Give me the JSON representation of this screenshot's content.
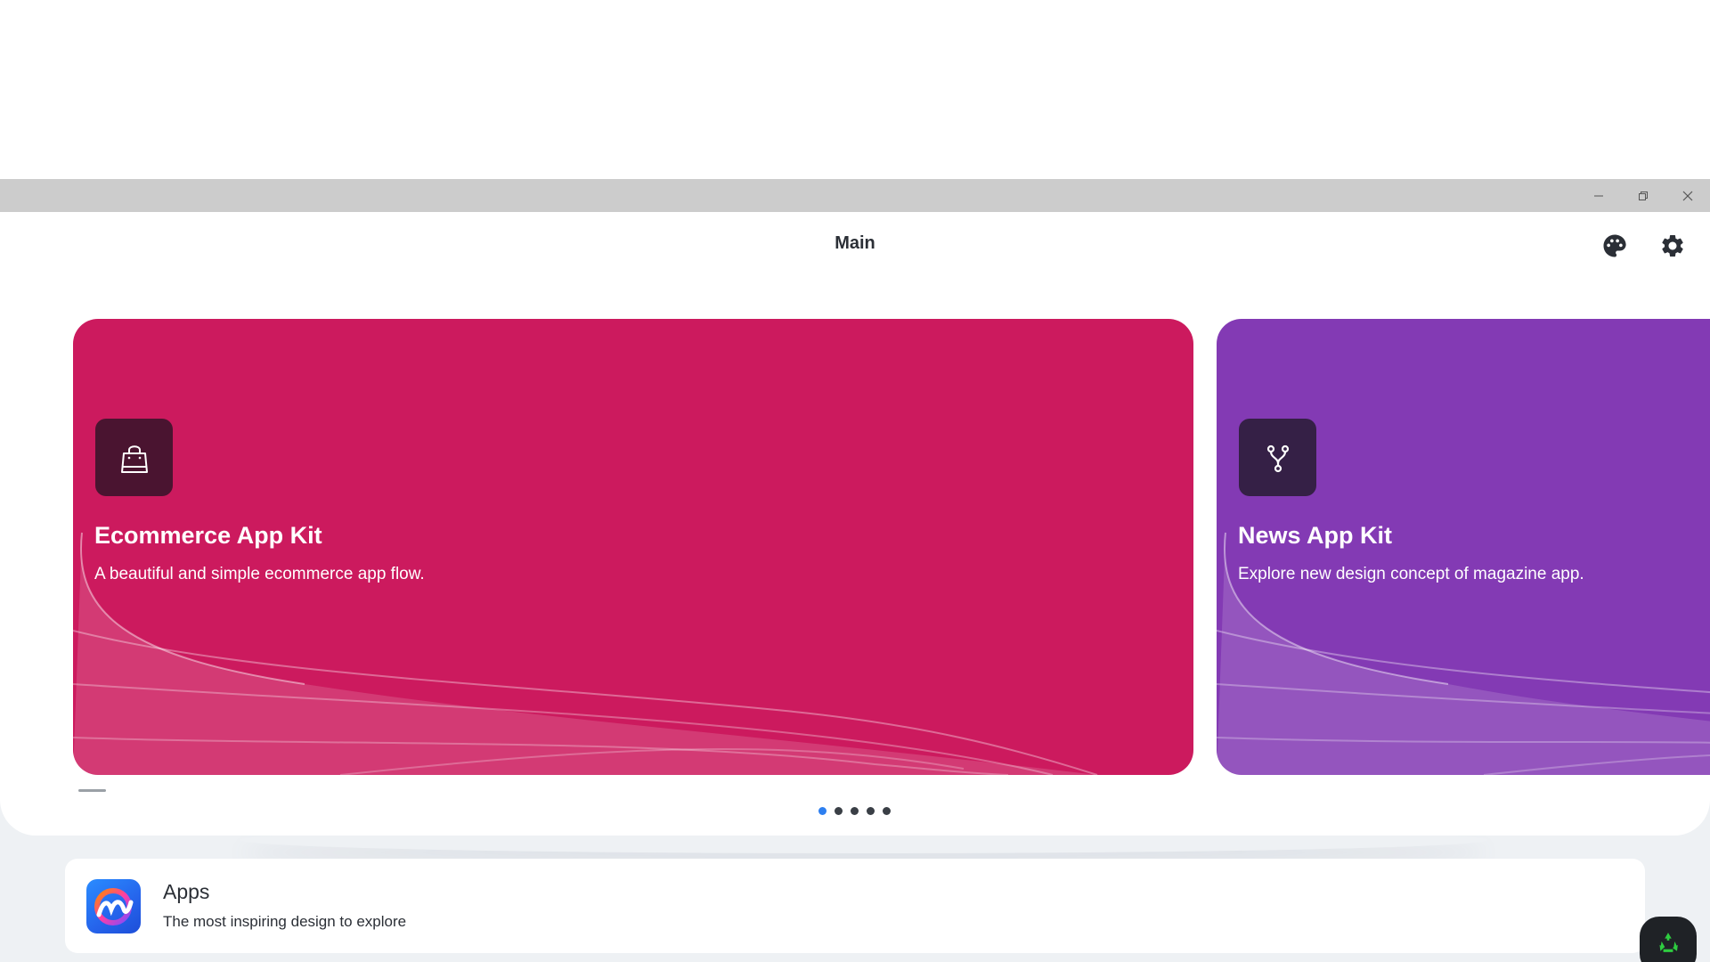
{
  "window": {
    "controls": [
      "minimize",
      "restore",
      "close"
    ]
  },
  "header": {
    "title": "Main",
    "icons": [
      "palette-icon",
      "settings-icon"
    ]
  },
  "carousel": {
    "cards": [
      {
        "title": "Ecommerce App Kit",
        "subtitle": "A beautiful and simple ecommerce app flow.",
        "icon": "shopping-bag-icon",
        "color": "#cc1a5e",
        "icon_bg": "#4a1430"
      },
      {
        "title": "News App Kit",
        "subtitle": "Explore new design concept of magazine app.",
        "icon": "fork-icon",
        "color": "#833ab4",
        "icon_bg": "#352046"
      }
    ],
    "page_count": 5,
    "active_page": 1
  },
  "apps": {
    "title": "Apps",
    "subtitle": "The most inspiring design to explore",
    "icon": "apps-logo-icon"
  },
  "fab": {
    "icon": "recycle-icon",
    "color": "#2ecc40"
  }
}
